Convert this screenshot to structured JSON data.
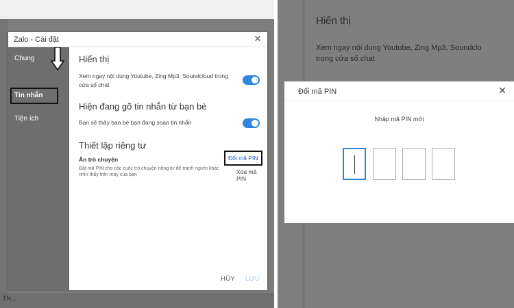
{
  "left": {
    "dialog": {
      "title": "Zalo - Cài đặt",
      "close_icon": "close-icon",
      "sidebar": {
        "items": [
          {
            "label": "Chung",
            "active": false
          },
          {
            "label": "Tin nhắn",
            "active": true
          },
          {
            "label": "Tiện ích",
            "active": false
          }
        ]
      },
      "content": {
        "section_display": {
          "heading": "Hiển thị",
          "description": "Xem ngay nội dung Youtube, Zing Mp3, Soundcloud trong cửa sổ chat",
          "toggle_on": true
        },
        "section_typing": {
          "heading": "Hiện đang gõ tin nhắn từ bạn bè",
          "description": "Bạn sẽ thấy bạn bè bạn đang soạn tin nhắn",
          "toggle_on": true
        },
        "section_privacy": {
          "heading": "Thiết lập riêng tư",
          "hide_chat_label": "Ẩn trò chuyện",
          "hide_chat_description": "Đặt mã PIN cho các cuộc trò chuyện riêng tư để tránh người khác nhìn thấy trên máy của bạn",
          "change_pin_label": "Đổi mã PIN",
          "delete_pin_label": "Xóa mã PIN"
        },
        "footer": {
          "cancel_label": "HỦY",
          "save_label": "LƯU"
        }
      }
    },
    "background_text": "TN..."
  },
  "right": {
    "background": {
      "heading": "Hiển thị",
      "text_line1": "Xem ngay nội dung Youtube, Zing Mp3, Soundclo",
      "text_line2": "trong cửa sổ chat"
    },
    "pin_dialog": {
      "title": "Đổi mã PIN",
      "prompt": "Nhập mã PIN mới",
      "digits": [
        "",
        "",
        "",
        ""
      ]
    }
  },
  "colors": {
    "accent": "#2e86de",
    "overlay": "#7f7f7f"
  }
}
